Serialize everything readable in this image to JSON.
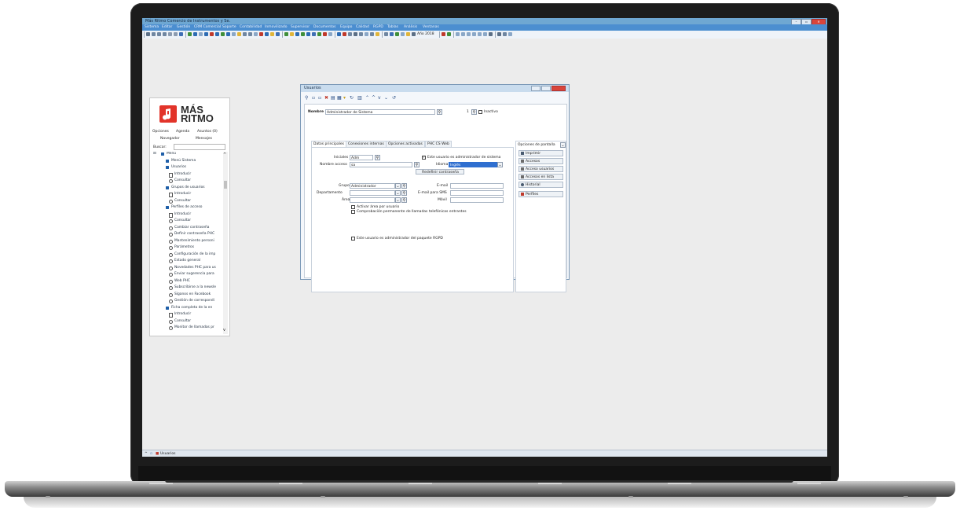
{
  "app": {
    "window_title": "Más Ritmo Comercio de Instrumentos y Se.",
    "menu": [
      "Sistema",
      "Editar",
      "Gestión",
      "CRM Comercial",
      "Soporte",
      "Contabilidad",
      "Inmovilizado",
      "Supervisor",
      "Documentos",
      "Equipo",
      "Calidad",
      "RGPD",
      "Tablas",
      "Análisis",
      "Ventanas"
    ],
    "toolbar_year": "Año 2018",
    "status_label": "Usuarios"
  },
  "nav": {
    "logo_line1": "MÁS",
    "logo_line2": "RITMO",
    "tabs": [
      "Opciones",
      "Agenda",
      "Asuntos (0)"
    ],
    "subtabs": [
      "Navegador",
      "Mensajes"
    ],
    "search_label": "Buscar:",
    "tree": [
      {
        "label": "Menú",
        "icon": "tree-root-icon"
      },
      {
        "label": "Menú Sistema",
        "icon": "folder-icon"
      },
      {
        "label": "Usuarios",
        "icon": "folder-icon"
      },
      {
        "label": "Introducir",
        "icon": "document-icon"
      },
      {
        "label": "Consultar",
        "icon": "circle-icon"
      },
      {
        "label": "Grupos de usuarios",
        "icon": "folder-icon"
      },
      {
        "label": "Introducir",
        "icon": "document-icon"
      },
      {
        "label": "Consultar",
        "icon": "circle-icon"
      },
      {
        "label": "Perfiles de acceso",
        "icon": "folder-icon"
      },
      {
        "label": "Introducir",
        "icon": "document-icon"
      },
      {
        "label": "Consultar",
        "icon": "circle-icon"
      },
      {
        "label": "Cambiar contraseña",
        "icon": "circle-icon"
      },
      {
        "label": "Definir contraseña PHC",
        "icon": "circle-icon"
      },
      {
        "label": "Mantenimiento personi",
        "icon": "circle-icon"
      },
      {
        "label": "Parámetros",
        "icon": "circle-icon"
      },
      {
        "label": "Configuración de la imp",
        "icon": "circle-icon"
      },
      {
        "label": "Estado general",
        "icon": "circle-icon"
      },
      {
        "label": "Novedades PHC para us",
        "icon": "circle-icon"
      },
      {
        "label": "Enviar sugerencia para",
        "icon": "circle-icon"
      },
      {
        "label": "Web PHC",
        "icon": "circle-icon"
      },
      {
        "label": "Subscribirse a la newsle",
        "icon": "circle-icon"
      },
      {
        "label": "Síganos en Facebook",
        "icon": "circle-icon"
      },
      {
        "label": "Gestión de correspondi",
        "icon": "circle-icon"
      },
      {
        "label": "Ficha completa de la en",
        "icon": "folder-icon"
      },
      {
        "label": "Introducir",
        "icon": "document-icon"
      },
      {
        "label": "Consultar",
        "icon": "circle-icon"
      },
      {
        "label": "Monitor de llamadas pr",
        "icon": "circle-icon"
      }
    ]
  },
  "dialog": {
    "title": "Usuarios",
    "nombre_label": "Nombre",
    "nombre_value": "Administrador de Sistema",
    "record_number": "1",
    "inactivo_label": "Inactivo",
    "tabs": [
      "Datos principales",
      "Conexiones internas",
      "Opciones activadas",
      "PHC CS Web"
    ],
    "screen_options_label": "Opciones de pantalla",
    "iniciales_label": "Iniciales",
    "iniciales_value": "Adm",
    "admin_sistema_label": "Este usuario es administrador de sistema",
    "nombre_acceso_label": "Nombre acceso",
    "nombre_acceso_value": "sa",
    "idioma_label": "Idioma",
    "idioma_value": "Inglés",
    "redefinir_label": "Redefinir contraseña",
    "grupo_label": "Grupo",
    "grupo_value": "Administrador",
    "departamento_label": "Departamento",
    "area_label": "Área",
    "email_label": "E-mail",
    "email_sms_label": "E-mail para SMS",
    "movil_label": "Móvil",
    "activar_area_label": "Activar área por usuario",
    "comprobacion_label": "Comprobación permanente de llamadas telefónicas entrantes",
    "rgpd_label": "Este usuario es administrador del paquete RGPD",
    "right_buttons": [
      {
        "label": "Imprimir",
        "icon": "printer-icon"
      },
      {
        "label": "Accesos",
        "icon": "key-icon"
      },
      {
        "label": "Acceso usuarios",
        "icon": "key-icon"
      },
      {
        "label": "Accesos en lista",
        "icon": "key-icon"
      },
      {
        "label": "Historial",
        "icon": "eye-icon"
      },
      {
        "label": "Perfiles",
        "icon": "profiles-icon"
      }
    ]
  },
  "colors": {
    "title_bar": "#6ea7d2",
    "menu_bar": "#4b8ed0",
    "logo_red": "#e2342a",
    "selected_field": "#2f6fd0"
  }
}
